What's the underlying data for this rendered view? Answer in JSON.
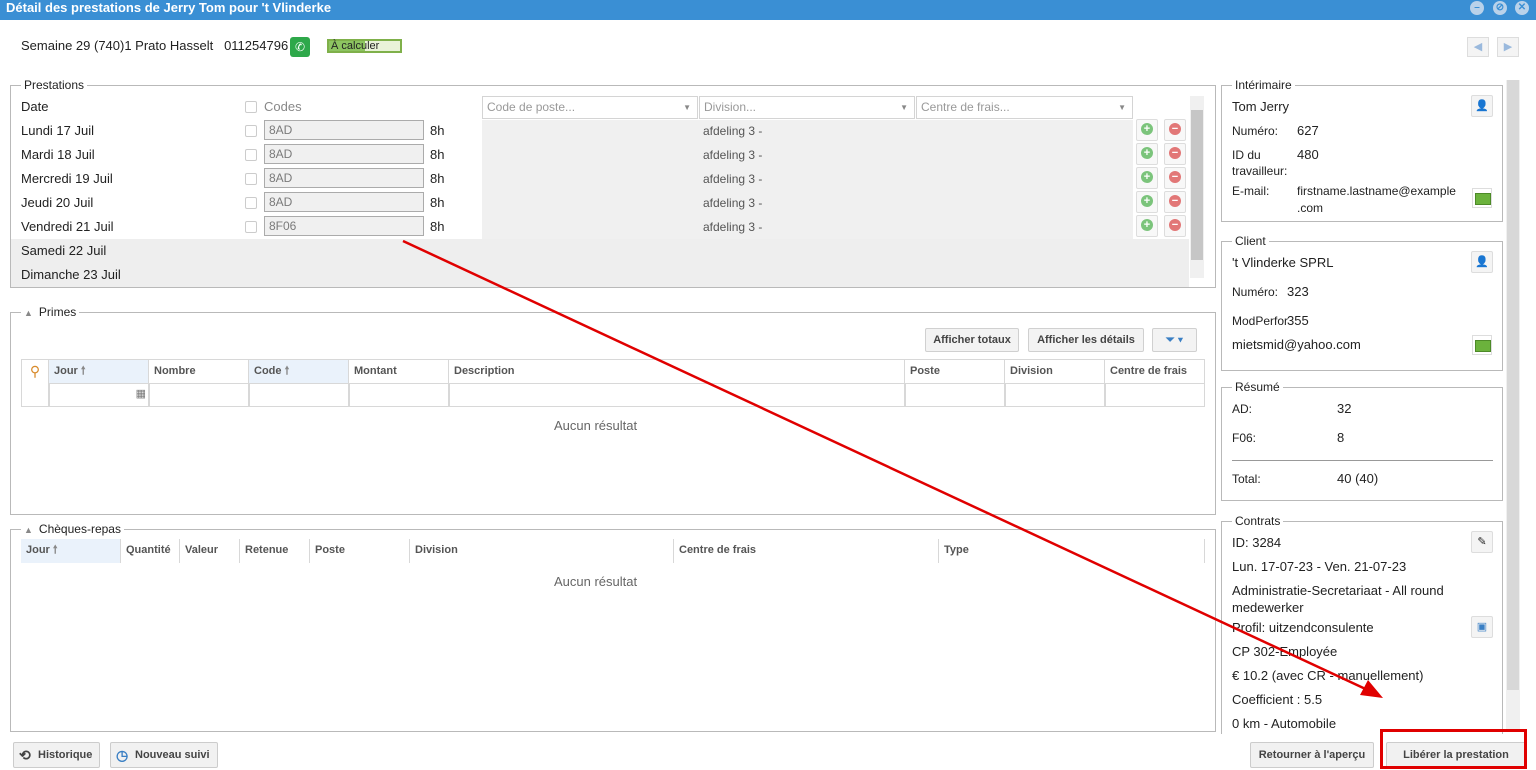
{
  "window": {
    "title": "Détail des prestations de Jerry Tom pour 't Vlinderke"
  },
  "header": {
    "info": "Semaine 29 (740)1 Prato Hasselt",
    "phone": "011254796",
    "status_label": "À calculer",
    "status_progress": 0.5
  },
  "prestations": {
    "legend": "Prestations",
    "date_label": "Date",
    "codes_label": "Codes",
    "poste_placeholder": "Code de poste...",
    "division_placeholder": "Division...",
    "centre_placeholder": "Centre de frais...",
    "rows": [
      {
        "day": "Lundi 17 Juil",
        "code": "8AD",
        "hours": "8h",
        "division": "afdeling 3 -"
      },
      {
        "day": "Mardi 18 Juil",
        "code": "8AD",
        "hours": "8h",
        "division": "afdeling 3 -"
      },
      {
        "day": "Mercredi 19 Juil",
        "code": "8AD",
        "hours": "8h",
        "division": "afdeling 3 -"
      },
      {
        "day": "Jeudi 20 Juil",
        "code": "8AD",
        "hours": "8h",
        "division": "afdeling 3 -"
      },
      {
        "day": "Vendredi 21 Juil",
        "code": "8F06",
        "hours": "8h",
        "division": "afdeling 3 -"
      }
    ],
    "weekend": [
      "Samedi 22 Juil",
      "Dimanche 23 Juil"
    ]
  },
  "primes": {
    "legend": "Primes",
    "btn_totaux": "Afficher totaux",
    "btn_details": "Afficher les détails",
    "columns": [
      "Jour",
      "Nombre",
      "Code",
      "Montant",
      "Description",
      "Poste",
      "Division",
      "Centre de frais"
    ],
    "empty": "Aucun résultat"
  },
  "cheques": {
    "legend": "Chèques-repas",
    "columns": [
      "Jour",
      "Quantité",
      "Valeur",
      "Retenue",
      "Poste",
      "Division",
      "Centre de frais",
      "Type"
    ],
    "empty": "Aucun résultat"
  },
  "interimaire": {
    "legend": "Intérimaire",
    "name": "Tom Jerry",
    "numero_label": "Numéro:",
    "numero": "627",
    "id_label_1": "ID du",
    "id_label_2": "travailleur:",
    "id": "480",
    "email_label": "E-mail:",
    "email_1": "firstname.lastname@example",
    "email_2": ".com"
  },
  "client": {
    "legend": "Client",
    "name": "'t Vlinderke SPRL",
    "numero_label": "Numéro:",
    "numero": "323",
    "modperfor_label": "ModPerfor",
    "modperfor": "355",
    "email": "mietsmid@yahoo.com"
  },
  "resume": {
    "legend": "Résumé",
    "ad_label": "AD:",
    "ad": "32",
    "f06_label": "F06:",
    "f06": "8",
    "total_label": "Total:",
    "total": "40  (40)"
  },
  "contrats": {
    "legend": "Contrats",
    "id": "ID: 3284",
    "dates": "Lun. 17-07-23 - Ven. 21-07-23",
    "role_1": "Administratie-Secretariaat - All round",
    "role_2": "medewerker",
    "profil": "Profil: uitzendconsulente",
    "cp": "CP 302-Employée",
    "wage": "€ 10.2 (avec CR - manuellement)",
    "coefficient": "Coefficient : 5.5",
    "km": "0 km - Automobile"
  },
  "footer": {
    "historique": "Historique",
    "nouveau_suivi": "Nouveau suivi",
    "retourner": "Retourner à l'aperçu",
    "liberer": "Libérer la prestation"
  },
  "colors": {
    "titlebar": "#3a8fd4",
    "highlight": "#e00000",
    "arrow": "#e00000",
    "status": "#8dc461"
  }
}
